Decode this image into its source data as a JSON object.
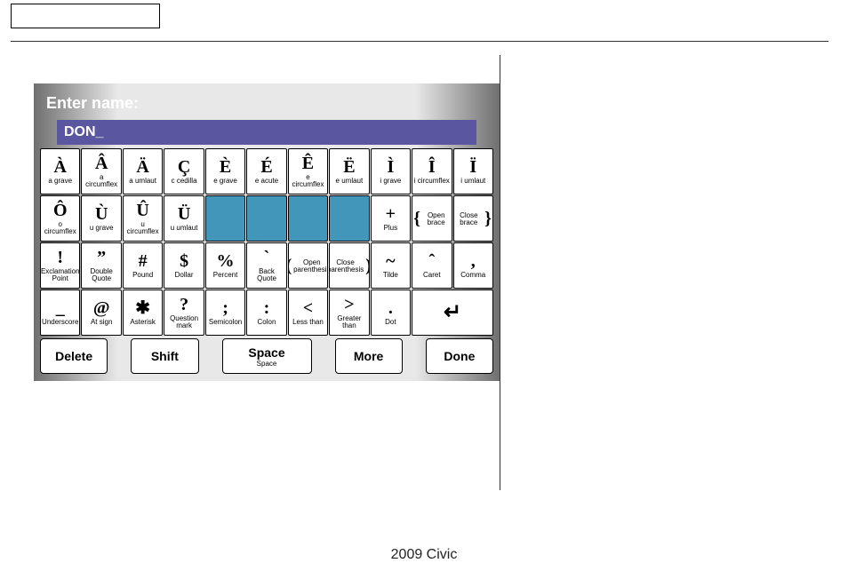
{
  "footer": "2009  Civic",
  "device": {
    "prompt": "Enter name:",
    "input_value": "DON_",
    "rows": [
      [
        {
          "glyph": "À",
          "label": "a grave"
        },
        {
          "glyph": "Â",
          "label": "a circumflex"
        },
        {
          "glyph": "Ä",
          "label": "a umlaut"
        },
        {
          "glyph": "Ç",
          "label": "c cedilla"
        },
        {
          "glyph": "È",
          "label": "e grave"
        },
        {
          "glyph": "É",
          "label": "e acute"
        },
        {
          "glyph": "Ê",
          "label": "e circumflex"
        },
        {
          "glyph": "Ë",
          "label": "e umlaut"
        },
        {
          "glyph": "Ì",
          "label": "i grave"
        },
        {
          "glyph": "Î",
          "label": "i circumflex"
        },
        {
          "glyph": "Ï",
          "label": "i umlaut"
        }
      ],
      [
        {
          "glyph": "Ô",
          "label": "o circumflex"
        },
        {
          "glyph": "Ù",
          "label": "u grave"
        },
        {
          "glyph": "Û",
          "label": "u circumflex"
        },
        {
          "glyph": "Ü",
          "label": "u umlaut"
        },
        {
          "blank": true
        },
        {
          "blank": true
        },
        {
          "blank": true
        },
        {
          "blank": true
        },
        {
          "glyph": "+",
          "label": "Plus"
        },
        {
          "brace": true,
          "glyph": "{",
          "label": "Open brace"
        },
        {
          "brace": true,
          "glyph": "}",
          "label": "Close brace"
        }
      ],
      [
        {
          "glyph": "!",
          "label": "Exclamation Point"
        },
        {
          "glyph": "”",
          "label": "Double Quote"
        },
        {
          "glyph": "#",
          "label": "Pound"
        },
        {
          "glyph": "$",
          "label": "Dollar"
        },
        {
          "glyph": "%",
          "label": "Percent"
        },
        {
          "glyph": "`",
          "label": "Back Quote"
        },
        {
          "brace": true,
          "glyph": "(",
          "label": "Open parenthesis"
        },
        {
          "brace": true,
          "glyph": ")",
          "label": "Close parenthesis"
        },
        {
          "glyph": "~",
          "label": "Tilde"
        },
        {
          "glyph": "ˆ",
          "label": "Caret"
        },
        {
          "glyph": ",",
          "label": "Comma"
        }
      ],
      [
        {
          "glyph": "_",
          "label": "Underscore"
        },
        {
          "glyph": "@",
          "label": "At sign"
        },
        {
          "glyph": "✱",
          "label": "Asterisk"
        },
        {
          "glyph": "?",
          "label": "Question mark"
        },
        {
          "glyph": ";",
          "label": "Semicolon"
        },
        {
          "glyph": ":",
          "label": "Colon"
        },
        {
          "glyph": "<",
          "label": "Less than"
        },
        {
          "glyph": ">",
          "label": "Greater than"
        },
        {
          "glyph": ".",
          "label": "Dot"
        },
        {
          "enter": true,
          "glyph": "↵"
        }
      ]
    ],
    "fn": {
      "delete": "Delete",
      "shift": "Shift",
      "space": "Space",
      "space_sub": "Space",
      "more": "More",
      "done": "Done"
    }
  }
}
